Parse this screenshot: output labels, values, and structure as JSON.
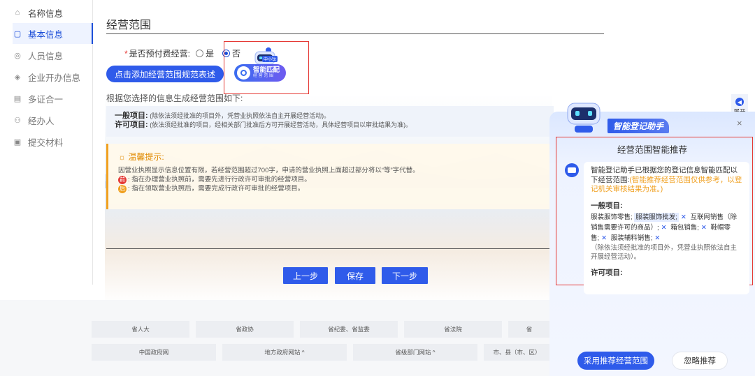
{
  "sidebar": {
    "items": [
      {
        "label": "名称信息",
        "icon": "home-icon",
        "glyph": "⌂"
      },
      {
        "label": "基本信息",
        "icon": "document-icon",
        "glyph": "▢"
      },
      {
        "label": "人员信息",
        "icon": "user-icon",
        "glyph": "◎"
      },
      {
        "label": "企业开办信息",
        "icon": "shield-icon",
        "glyph": "◈"
      },
      {
        "label": "多证合一",
        "icon": "certificate-icon",
        "glyph": "▤"
      },
      {
        "label": "经办人",
        "icon": "person-icon",
        "glyph": "⚇"
      },
      {
        "label": "提交材料",
        "icon": "file-icon",
        "glyph": "▣"
      }
    ]
  },
  "main": {
    "title": "经营范围",
    "prepay": {
      "label": "是否预付费经营:",
      "required_mark": "*",
      "options": [
        "是",
        "否"
      ],
      "selected": "否"
    },
    "add_button": "点击添加经营范围规范表述",
    "smart_match": {
      "title": "智能匹配",
      "subtitle": "经 营 范 围",
      "badge": "中小钛"
    },
    "generated_text": "根据您选择的信息生成经营范围如下:",
    "scope": {
      "general_label": "一般项目:",
      "general_text": "(除依法须经批准的项目外，凭营业执照依法自主开展经营活动)。",
      "licensed_label": "许可项目:",
      "licensed_text": "(依法须经批准的项目，经相关部门批准后方可开展经营活动，具体经营项目以审批结果为准)。"
    },
    "tips": {
      "title": "温馨提示:",
      "line1": "因营业执照显示信息位置有限，若经营范围超过700字，申请的营业执照上面超过部分将以“等”字代替。",
      "badge_before": "前",
      "line2": ": 指在办理营业执照前，需要先进行行政许可审批的经营项目。",
      "badge_after": "后",
      "line3": ": 指在领取营业执照后，需要完成行政许可审批的经营项目。"
    },
    "buttons": {
      "prev": "上一步",
      "save": "保存",
      "next": "下一步"
    }
  },
  "footer": {
    "row1": [
      "省人大",
      "省政协",
      "省纪委、省监委",
      "省法院",
      "省"
    ],
    "row2": [
      "中国政府网",
      "地方政府网站 ^",
      "省级部门网站 ^",
      "市、县（市、区）"
    ]
  },
  "expand": {
    "label": "展开"
  },
  "assistant": {
    "title": "智能登记助手",
    "close": "×",
    "subtitle": "经营范围智能推荐",
    "intro": "智能登记助手已根据您的登记信息智能匹配以下经营范围:",
    "intro_note": "(智能推荐经营范围仅供参考，以登记机关审核结果为准。)",
    "general_label": "一般项目:",
    "items": [
      "服装服饰零售;",
      "服装服饰批发;",
      "互联网销售（除销售需要许可的商品）;",
      "箱包销售;",
      "鞋帽零售;",
      "服装辅料销售;"
    ],
    "note": "（除依法须经批准的项目外，凭营业执照依法自主开展经营活动）。",
    "licensed_label": "许可项目:",
    "use_button": "采用推荐经营范围",
    "ignore_button": "忽略推荐"
  },
  "colors": {
    "primary": "#2f5bea",
    "highlight_border": "#e53935",
    "tip_accent": "#f0a020"
  }
}
